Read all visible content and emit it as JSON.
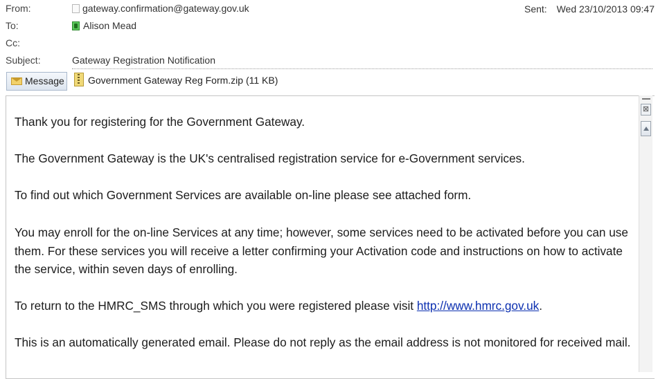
{
  "header": {
    "from_label": "From:",
    "from_value": "gateway.confirmation@gateway.gov.uk",
    "to_label": "To:",
    "to_value": "Alison Mead",
    "cc_label": "Cc:",
    "cc_value": "",
    "subject_label": "Subject:",
    "subject_value": "Gateway Registration Notification",
    "sent_label": "Sent:",
    "sent_value": "Wed 23/10/2013 09:47"
  },
  "attachments": {
    "message_tab": "Message",
    "file": "Government Gateway Reg Form.zip (11 KB)"
  },
  "body": {
    "p1": "Thank you for registering for the Government Gateway.",
    "p2": "The Government Gateway is the UK's centralised registration service for e-Government services.",
    "p3": "To find out which Government Services are available on-line please see attached form.",
    "p4": "You may enroll for the on-line Services at any time; however, some services need to be activated before you can use them. For these services you will receive a letter confirming your Activation code and instructions on how to activate the service, within seven days of enrolling.",
    "p5_prefix": "To return to the HMRC_SMS through which you were registered please visit ",
    "p5_link": "http://www.hmrc.gov.uk",
    "p5_suffix": ".",
    "p6": "This is an automatically generated email. Please do not reply as the email address is not monitored for received mail."
  },
  "icons": {
    "from_checkbox": "checkbox-icon",
    "to_presence": "presence-icon",
    "message_tab": "envelope-icon",
    "attachment": "zip-file-icon",
    "scroll_up": "scroll-up-arrow-icon"
  }
}
